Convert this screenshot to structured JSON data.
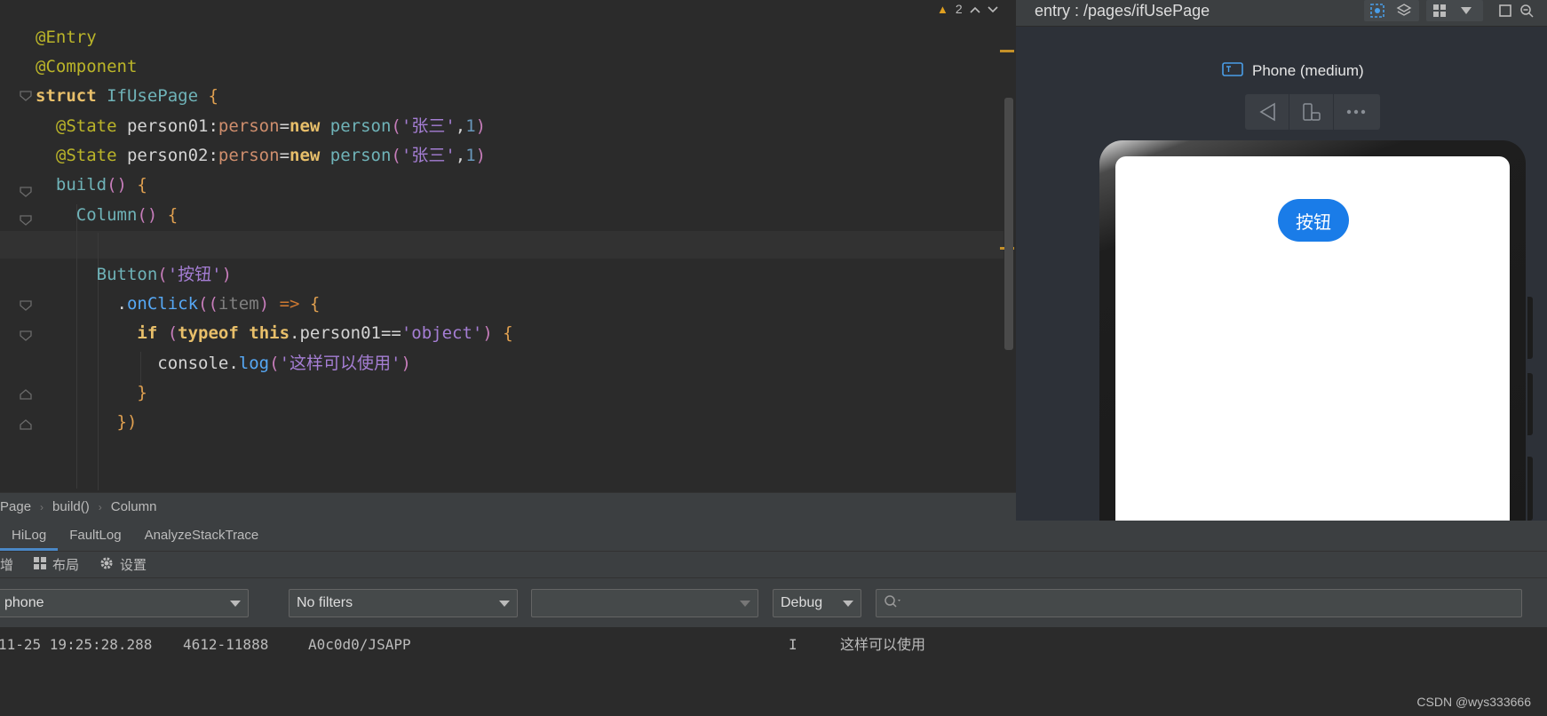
{
  "editor": {
    "warning_count": "2",
    "lines": [
      {
        "tokens": [
          {
            "t": "@Entry",
            "c": "ann"
          }
        ]
      },
      {
        "tokens": [
          {
            "t": "@Component",
            "c": "ann"
          }
        ]
      },
      {
        "tokens": [
          {
            "t": "struct ",
            "c": "kw"
          },
          {
            "t": "IfUsePage ",
            "c": "cls"
          },
          {
            "t": "{",
            "c": "brk"
          }
        ]
      },
      {
        "tokens": [
          {
            "t": "  @State ",
            "c": "ann"
          },
          {
            "t": "person01",
            "c": "plain"
          },
          {
            "t": ":",
            "c": "plain"
          },
          {
            "t": "person",
            "c": "typ"
          },
          {
            "t": "=",
            "c": "plain"
          },
          {
            "t": "new ",
            "c": "kw"
          },
          {
            "t": "person",
            "c": "cls"
          },
          {
            "t": "(",
            "c": "brk2"
          },
          {
            "t": "'张三'",
            "c": "str"
          },
          {
            "t": ",",
            "c": "plain"
          },
          {
            "t": "1",
            "c": "num"
          },
          {
            "t": ")",
            "c": "brk2"
          }
        ]
      },
      {
        "tokens": [
          {
            "t": "  @State ",
            "c": "ann"
          },
          {
            "t": "person02",
            "c": "plain"
          },
          {
            "t": ":",
            "c": "plain"
          },
          {
            "t": "person",
            "c": "typ"
          },
          {
            "t": "=",
            "c": "plain"
          },
          {
            "t": "new ",
            "c": "kw"
          },
          {
            "t": "person",
            "c": "cls"
          },
          {
            "t": "(",
            "c": "brk2"
          },
          {
            "t": "'张三'",
            "c": "str"
          },
          {
            "t": ",",
            "c": "plain"
          },
          {
            "t": "1",
            "c": "num"
          },
          {
            "t": ")",
            "c": "brk2"
          }
        ]
      },
      {
        "tokens": [
          {
            "t": "  build",
            "c": "cls"
          },
          {
            "t": "() ",
            "c": "brk2"
          },
          {
            "t": "{",
            "c": "brk"
          }
        ]
      },
      {
        "tokens": [
          {
            "t": "    Column",
            "c": "cls"
          },
          {
            "t": "() ",
            "c": "brk2"
          },
          {
            "t": "{",
            "c": "brk"
          }
        ]
      },
      {
        "tokens": [
          {
            "t": "",
            "c": "plain"
          }
        ]
      },
      {
        "tokens": [
          {
            "t": "      Button",
            "c": "cls"
          },
          {
            "t": "(",
            "c": "brk2"
          },
          {
            "t": "'按钮'",
            "c": "str"
          },
          {
            "t": ")",
            "c": "brk2"
          }
        ]
      },
      {
        "tokens": [
          {
            "t": "        .",
            "c": "plain"
          },
          {
            "t": "onClick",
            "c": "fn"
          },
          {
            "t": "((",
            "c": "brk2"
          },
          {
            "t": "item",
            "c": "prm"
          },
          {
            "t": ") ",
            "c": "brk2"
          },
          {
            "t": "=> ",
            "c": "kw2"
          },
          {
            "t": "{",
            "c": "brk"
          }
        ]
      },
      {
        "tokens": [
          {
            "t": "          if ",
            "c": "kw"
          },
          {
            "t": "(",
            "c": "brk2"
          },
          {
            "t": "typeof ",
            "c": "kw"
          },
          {
            "t": "this",
            "c": "kw"
          },
          {
            "t": ".person01==",
            "c": "plain"
          },
          {
            "t": "'object'",
            "c": "str"
          },
          {
            "t": ") ",
            "c": "brk2"
          },
          {
            "t": "{",
            "c": "brk"
          }
        ]
      },
      {
        "tokens": [
          {
            "t": "            console",
            "c": "plain"
          },
          {
            "t": ".",
            "c": "plain"
          },
          {
            "t": "log",
            "c": "fn"
          },
          {
            "t": "(",
            "c": "brk2"
          },
          {
            "t": "'这样可以使用'",
            "c": "str"
          },
          {
            "t": ")",
            "c": "brk2"
          }
        ]
      },
      {
        "tokens": [
          {
            "t": "          }",
            "c": "brk"
          }
        ]
      },
      {
        "tokens": [
          {
            "t": "        })",
            "c": "brk"
          }
        ]
      }
    ]
  },
  "breadcrumb": [
    "Page",
    "build()",
    "Column"
  ],
  "previewer": {
    "title": "entry : /pages/ifUsePage",
    "device": "Phone (medium)",
    "button_label": "按钮"
  },
  "log": {
    "tabs": [
      "HiLog",
      "FaultLog",
      "AnalyzeStackTrace"
    ],
    "toolbar": {
      "item1": "增",
      "item2": "布局",
      "item3": "设置"
    },
    "filters": {
      "device": "phone",
      "filter": "No filters",
      "process": "",
      "level": "Debug",
      "search_placeholder": ""
    },
    "entry": {
      "time": "11-25 19:25:28.288",
      "pid": "4612-11888",
      "tag": "A0c0d0/JSAPP",
      "level": "I",
      "message": "这样可以使用"
    }
  },
  "watermark": "CSDN @wys333666"
}
